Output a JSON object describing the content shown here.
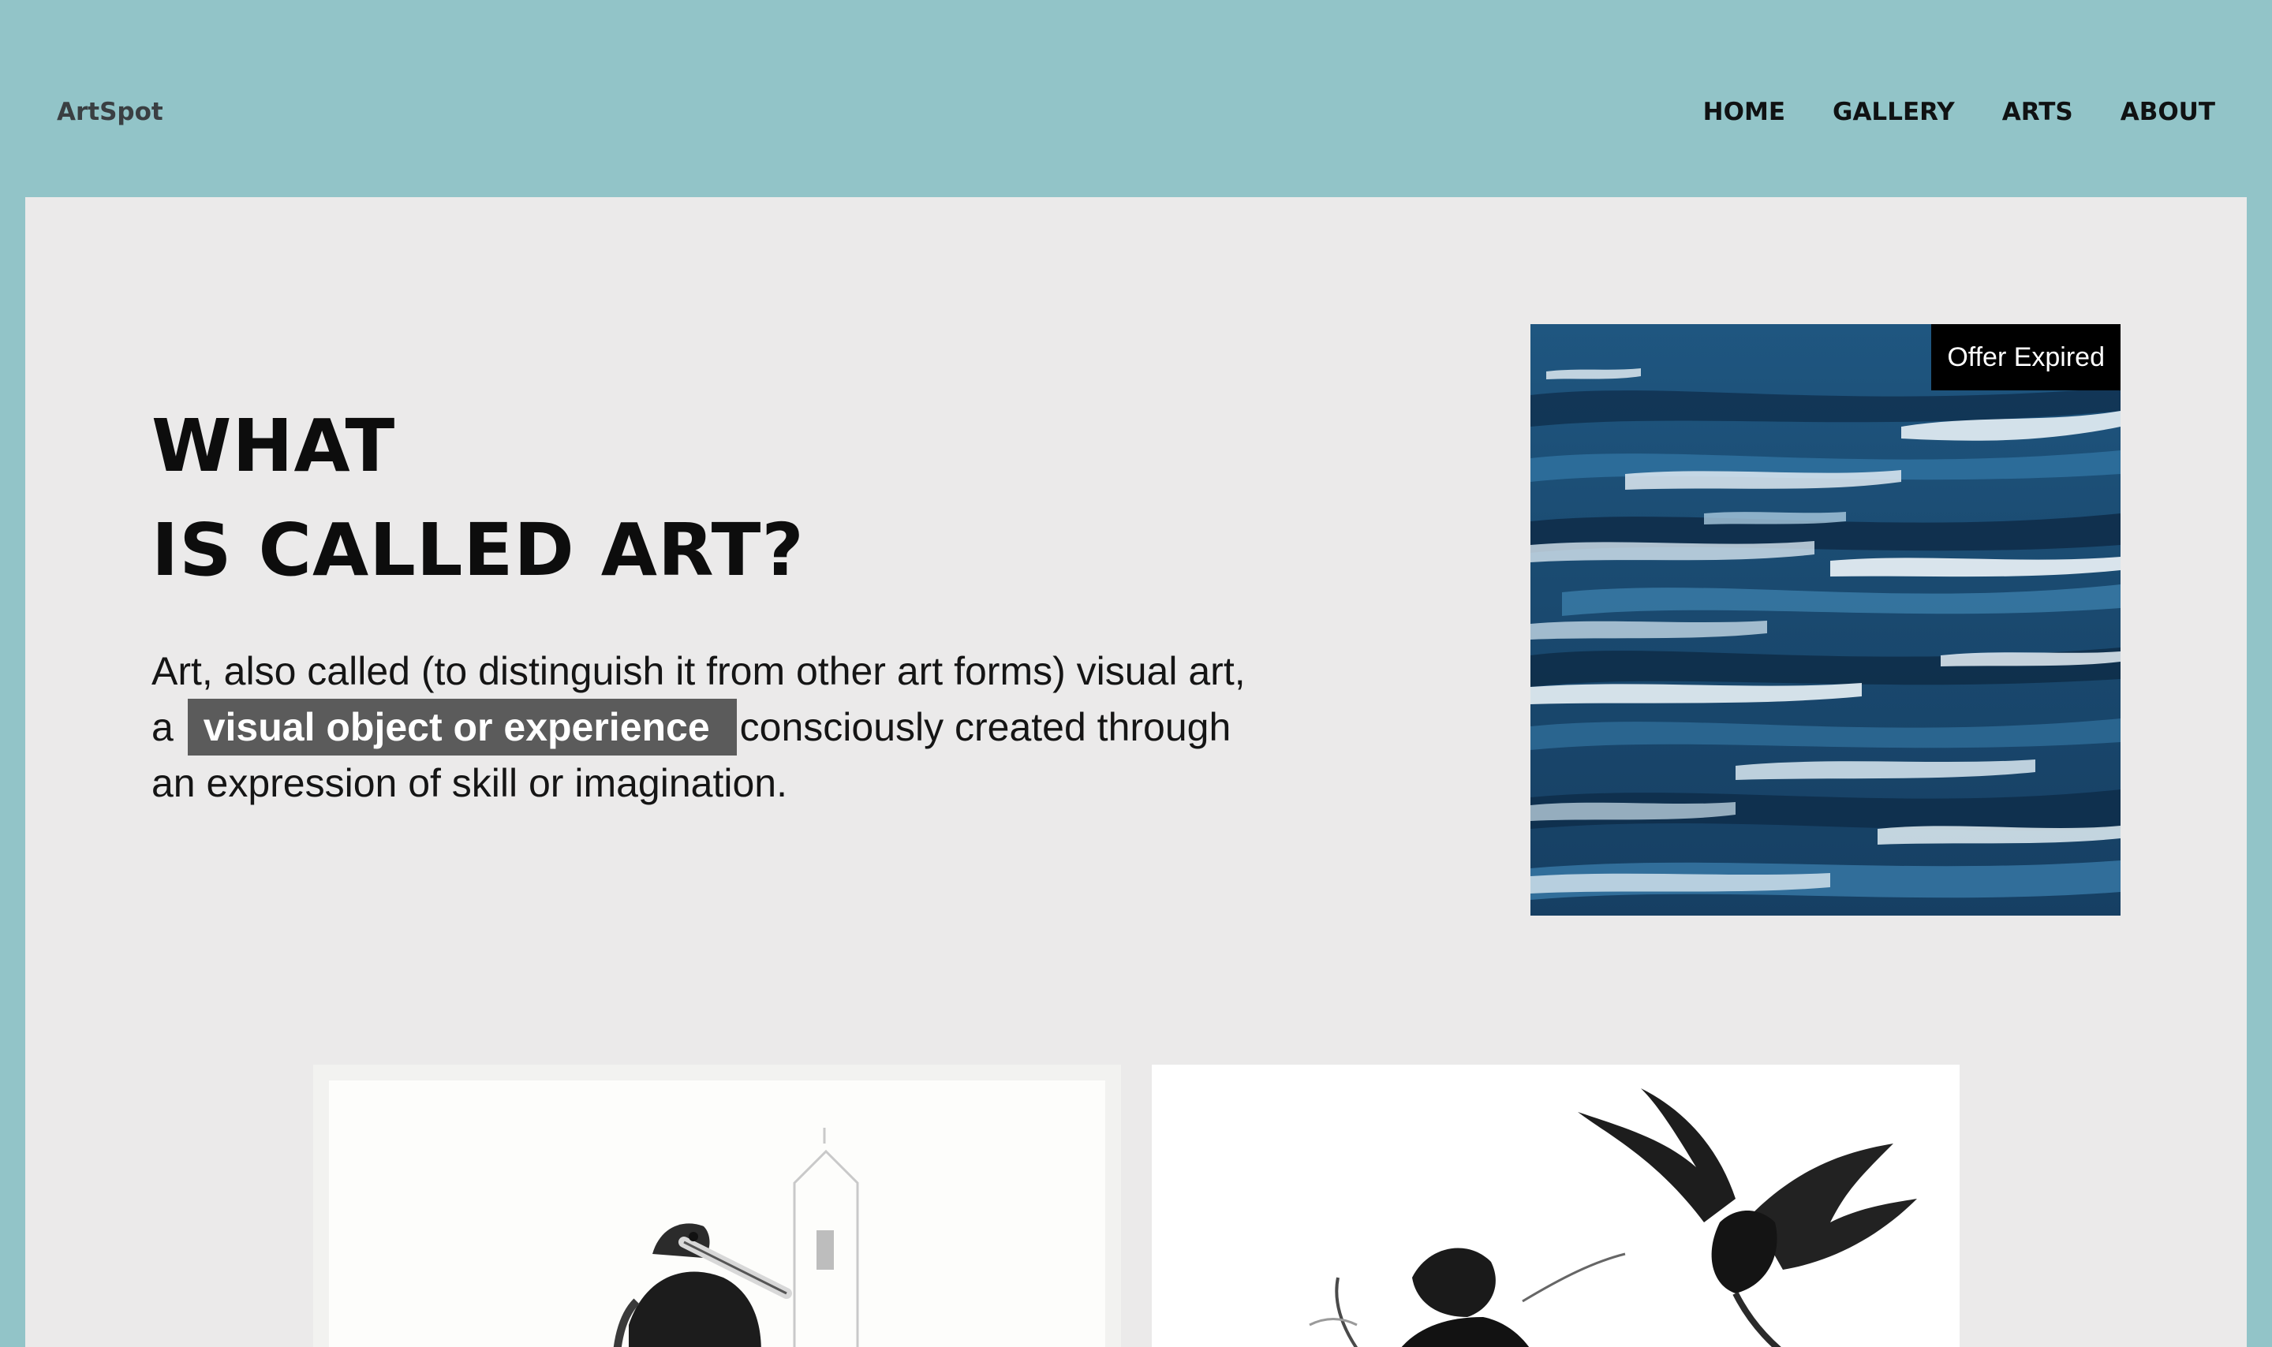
{
  "brand": {
    "name": "ArtSpot"
  },
  "nav": {
    "items": [
      "HOME",
      "GALLERY",
      "ARTS",
      "ABOUT"
    ]
  },
  "hero": {
    "title_line_1": "WHAT",
    "title_line_2": "IS CALLED ART?",
    "text_before": "Art, also called (to distinguish it from other art forms) visual art, a",
    "text_highlight": "visual object or experience",
    "text_after": "consciously created through an expression of skill or imagination."
  },
  "feature": {
    "badge": "Offer Expired",
    "colors": {
      "deep": "#16375a",
      "mid": "#2c6a96",
      "light": "#7fb1d3",
      "white": "#e8f1f6"
    }
  },
  "gallery": {
    "thumbnails": [
      {
        "subject": "knight-with-sword-sketch"
      },
      {
        "subject": "warrior-with-eagle-sketch"
      }
    ]
  },
  "colors": {
    "page_background": "#92c4c8",
    "card_background": "#ebeaea",
    "highlight_background": "#5b5b5b",
    "badge_background": "#000000"
  }
}
